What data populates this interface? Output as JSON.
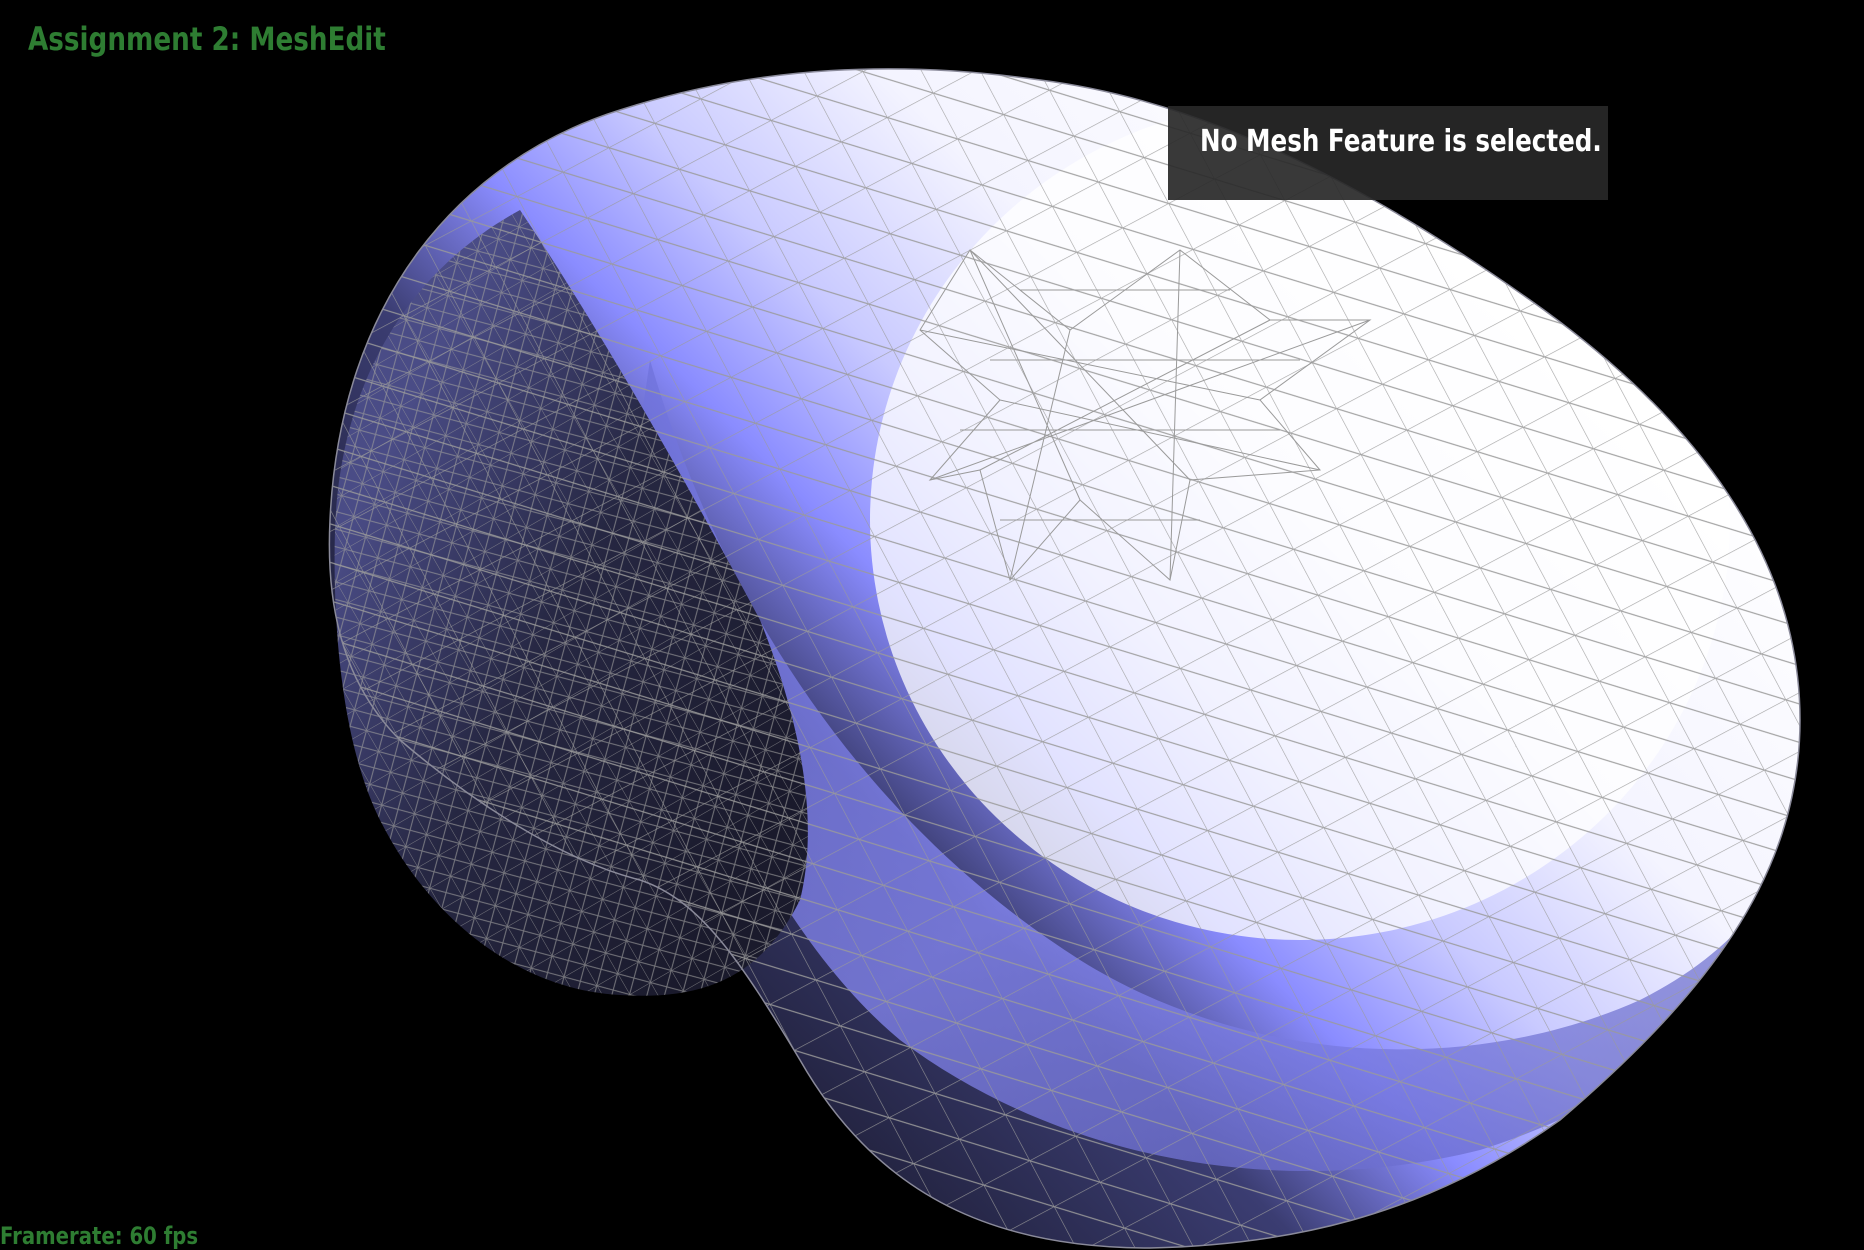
{
  "app": {
    "title": "Assignment 2: MeshEdit"
  },
  "status": {
    "framerate": "Framerate: 60 fps"
  },
  "info_panel": {
    "message": "No Mesh Feature is selected."
  },
  "colors": {
    "background": "#000000",
    "hud_text": "#2e7d32",
    "mesh_highlight": "#ffffff",
    "mesh_mid": "#9a9cff",
    "mesh_shadow": "#1b1b2e",
    "wireframe": "#9a9a9a",
    "panel_bg": "#282828"
  }
}
